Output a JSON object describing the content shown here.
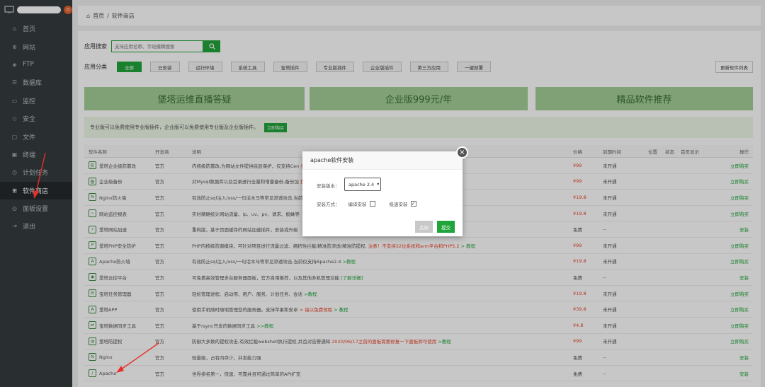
{
  "sidebar": {
    "badge_count": "0",
    "items": [
      {
        "icon": "home-icon",
        "glyph": "⌂",
        "label": "首页"
      },
      {
        "icon": "globe-icon",
        "glyph": "⊕",
        "label": "网站"
      },
      {
        "icon": "ftp-icon",
        "glyph": "◈",
        "label": "FTP"
      },
      {
        "icon": "database-icon",
        "glyph": "☰",
        "label": "数据库"
      },
      {
        "icon": "monitor-icon",
        "glyph": "▭",
        "label": "监控"
      },
      {
        "icon": "shield-icon",
        "glyph": "◇",
        "label": "安全"
      },
      {
        "icon": "folder-icon",
        "glyph": "▢",
        "label": "文件"
      },
      {
        "icon": "terminal-icon",
        "glyph": "▣",
        "label": "终端"
      },
      {
        "icon": "clock-icon",
        "glyph": "◷",
        "label": "计划任务"
      },
      {
        "icon": "apps-icon",
        "glyph": "⊞",
        "label": "软件商店"
      },
      {
        "icon": "settings-icon",
        "glyph": "◎",
        "label": "面板设置"
      },
      {
        "icon": "logout-icon",
        "glyph": "⇥",
        "label": "退出"
      }
    ],
    "active_index": 9
  },
  "breadcrumb": {
    "home": "首页",
    "sep": "/",
    "current": "软件商店"
  },
  "search": {
    "label": "应用搜索",
    "placeholder": "支持应用名称、字段模糊搜索"
  },
  "categories": {
    "label": "应用分类",
    "items": [
      "全部",
      "已安装",
      "运行环境",
      "系统工具",
      "宝塔插件",
      "专业版插件",
      "企业版插件",
      "第三方应用",
      "一键部署"
    ],
    "active_index": 0,
    "refresh_label": "更新软件列表"
  },
  "banners": [
    "堡塔运维直播答疑",
    "企业版999元/年",
    "精品软件推荐"
  ],
  "notice": {
    "text": "专业版可以免费使用专业版插件，企业版可以免费使用专业版及企业版插件。",
    "button": "立即购买"
  },
  "table": {
    "headers": {
      "name": "软件名称",
      "dev": "开发商",
      "desc": "说明",
      "price": "价格",
      "expire": "到期时间",
      "location": "位置",
      "status": "状态",
      "home": "首页显示",
      "op": "操作"
    },
    "rows": [
      {
        "icon": "防",
        "name": "堡塔企业级防篡改",
        "dev": "官方",
        "desc": "内核级防篡改,为网站文件提供底层保护，仅支持Cen",
        "extra": "免费用",
        "tut": ">教程",
        "price": "¥99",
        "price_red": true,
        "expire": "未开通",
        "op": "立即购买"
      },
      {
        "icon": "备",
        "name": "企业级备份",
        "dev": "官方",
        "desc": "对Mysql数据库以及目录进行全量和增量备份,备份加",
        "extra": "费领取",
        "tut": ">教程",
        "price": "¥99",
        "price_red": true,
        "expire": "未开通",
        "op": "立即购买"
      },
      {
        "icon": "N",
        "name": "Nginx防火墙",
        "dev": "官方",
        "desc": "有效防止sql注入/xss/一句话木马等常见渗透攻击,当前",
        "extra": "",
        "tut": "",
        "price": "¥19.8",
        "price_red": true,
        "expire": "未开通",
        "op": "立即购买"
      },
      {
        "icon": "~",
        "name": "网站监控报表",
        "dev": "官方",
        "desc": "实时精确统计网站流量、ip、uv、pv、请求、蜘蛛等",
        "extra": "",
        "tut": "",
        "price": "¥19.8",
        "price_red": true,
        "expire": "未开通",
        "op": "立即购买"
      },
      {
        "icon": "⚡",
        "name": "堡塔网站加速",
        "dev": "官方",
        "desc": "重构版，基于页面缓存的网站加速插件，安装或升级",
        "extra": "",
        "tut": "",
        "price": "免费",
        "price_red": false,
        "expire": "--",
        "op": "安装"
      },
      {
        "icon": "P",
        "name": "堡塔PHP安全防护",
        "dev": "官方",
        "desc": "PHP内核级防御模块，可针对项目进行流量过滤、拥挤性拦截/精准防渗透/精准防提权,",
        "extra": "注意！不支持32位系统和arm平台和PHP5.2",
        "tut": "> 教程",
        "price": "¥99",
        "price_red": true,
        "expire": "未开通",
        "op": "立即购买"
      },
      {
        "icon": "A",
        "name": "Apache防火墙",
        "dev": "官方",
        "desc": "有效防止sql注入/xss/一句话木马等常见渗透攻击,当前仅支持Apache2.4",
        "extra": "",
        "tut": ">教程",
        "price": "¥19.8",
        "price_red": true,
        "expire": "未开通",
        "op": "立即购买"
      },
      {
        "icon": "◉",
        "name": "堡塔云控平台",
        "dev": "官方",
        "desc": "可免费高效管理多台服务器面板，官方自用推荐，以及其他多机管理功能",
        "extra": "",
        "tut": "[了解详细]",
        "price": "免费",
        "price_red": false,
        "expire": "--",
        "op": "安装"
      },
      {
        "icon": "☰",
        "name": "宝塔任务管理器",
        "dev": "官方",
        "desc": "轻松管理进程、启动项、用户、服务、计划任务、会话",
        "extra": "",
        "tut": ">教程",
        "price": "¥19.8",
        "price_red": true,
        "expire": "未开通",
        "op": "立即购买"
      },
      {
        "icon": "A",
        "name": "堡塔APP",
        "dev": "官方",
        "desc": "使用手机随时随地管理您的服务器。支持苹果和安卓",
        "extra": "> 福以免费领取",
        "tut": "> 教程",
        "price": "¥39.8",
        "price_red": true,
        "expire": "未开通",
        "op": "立即购买"
      },
      {
        "icon": "⇄",
        "name": "宝塔数据同步工具",
        "dev": "官方",
        "desc": "基于rsync开发的数据同步工具",
        "extra": "",
        "tut": ">>教程",
        "price": "¥4.8",
        "price_red": true,
        "expire": "未开通",
        "op": "立即购买"
      },
      {
        "icon": "◍",
        "name": "堡塔防提权",
        "dev": "官方",
        "desc": "防御大多数的提权攻击,有效拦截webshell执行提权,并且对告警通知",
        "extra": "2020/06/17之前的面板需要修复一下面板即可使用",
        "tut": ">教程",
        "price": "¥99",
        "price_red": true,
        "expire": "未开通",
        "op": "立即购买"
      },
      {
        "icon": "N",
        "name": "Nginx",
        "dev": "官方",
        "desc": "轻量级，占有内存少，并发能力强",
        "extra": "",
        "tut": "",
        "price": "免费",
        "price_red": false,
        "expire": "--",
        "op": "安装"
      },
      {
        "icon": "/",
        "name": "Apache",
        "dev": "官方",
        "desc": "世界排名第一，快速、可靠并且可通过简单的API扩充",
        "extra": "",
        "tut": "",
        "price": "免费",
        "price_red": false,
        "expire": "--",
        "op": "安装"
      }
    ]
  },
  "modal": {
    "title": "apache软件安装",
    "version_label": "安装版本：",
    "version_value": "apache 2.4",
    "method_label": "安装方式：",
    "compile_label": "编译安装",
    "compile_checked": false,
    "fast_label": "极速安装",
    "fast_checked": true,
    "close_label": "关闭",
    "submit_label": "提交",
    "close_glyph": "×"
  }
}
